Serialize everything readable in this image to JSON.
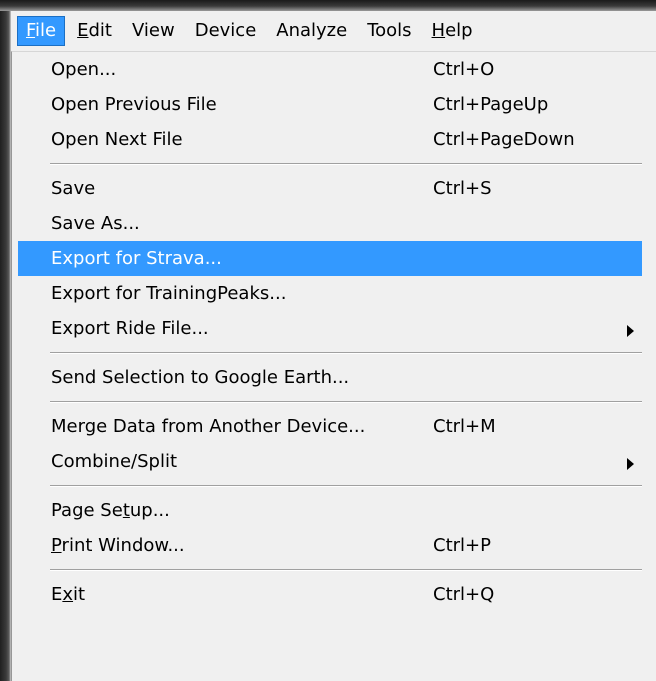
{
  "menubar": {
    "items": [
      {
        "label": "File",
        "mnemonic_index": 0,
        "active": true
      },
      {
        "label": "Edit",
        "mnemonic_index": 0
      },
      {
        "label": "View"
      },
      {
        "label": "Device"
      },
      {
        "label": "Analyze"
      },
      {
        "label": "Tools"
      },
      {
        "label": "Help",
        "mnemonic_index": 0
      }
    ]
  },
  "file_menu": {
    "groups": [
      [
        {
          "label": "Open...",
          "shortcut": "Ctrl+O"
        },
        {
          "label": "Open Previous File",
          "shortcut": "Ctrl+PageUp"
        },
        {
          "label": "Open Next File",
          "shortcut": "Ctrl+PageDown"
        }
      ],
      [
        {
          "label": "Save",
          "shortcut": "Ctrl+S"
        },
        {
          "label": "Save As...",
          "shortcut": ""
        },
        {
          "label": "Export for Strava...",
          "shortcut": "",
          "highlighted": true
        },
        {
          "label": "Export for TrainingPeaks...",
          "shortcut": ""
        },
        {
          "label": "Export Ride File...",
          "shortcut": "",
          "submenu": true
        }
      ],
      [
        {
          "label": "Send Selection to Google Earth...",
          "shortcut": ""
        }
      ],
      [
        {
          "label": "Merge Data from Another Device...",
          "shortcut": "Ctrl+M"
        },
        {
          "label": "Combine/Split",
          "shortcut": "",
          "submenu": true
        }
      ],
      [
        {
          "label": "Page Setup...",
          "shortcut": ""
        },
        {
          "label": "Print Window...",
          "shortcut": "Ctrl+P"
        }
      ],
      [
        {
          "label": "Exit",
          "shortcut": "Ctrl+Q"
        }
      ]
    ]
  },
  "colors": {
    "highlight": "#3399ff",
    "menu_background": "#f0f0f0",
    "separator": "#a0a0a0"
  }
}
